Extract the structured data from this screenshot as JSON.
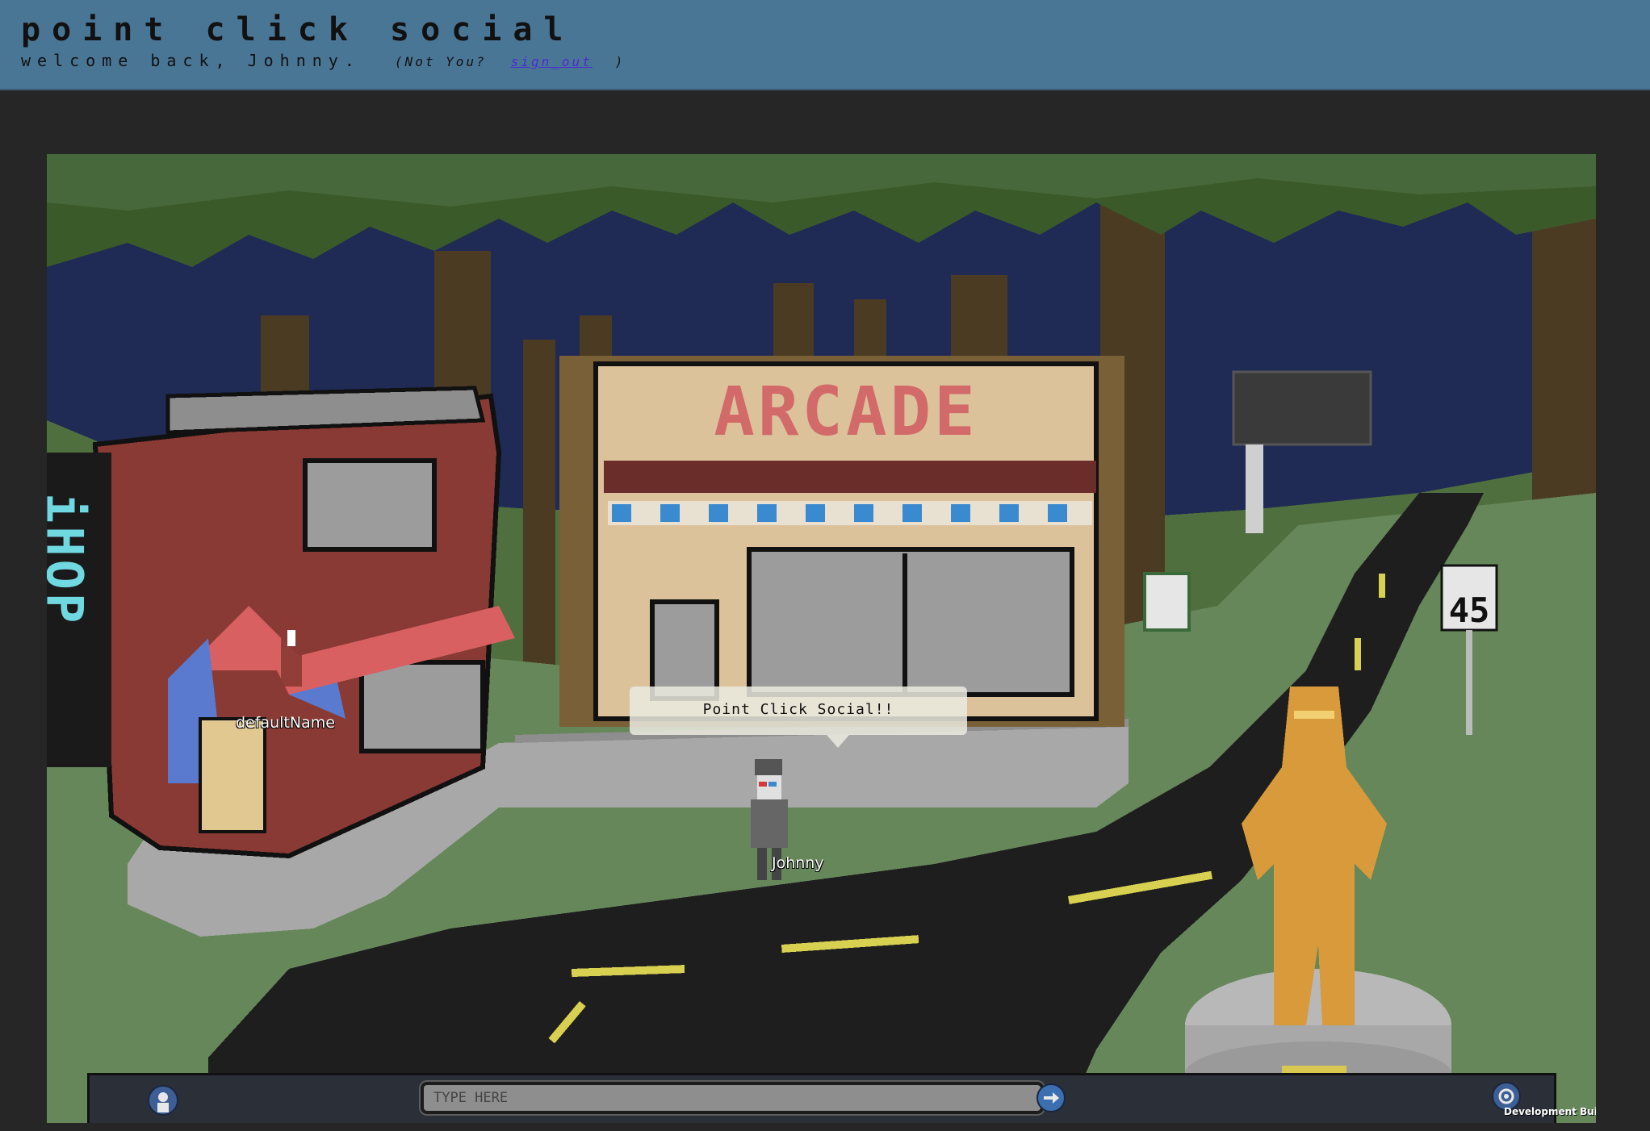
{
  "header": {
    "title": "point click social",
    "welcome": "welcome back, Johnny.",
    "not_you_prefix": "(Not You?",
    "sign_out_label": "sign_out",
    "not_you_suffix": ")"
  },
  "scene": {
    "shop_sign": "iHOP",
    "building_sign": "ARCADE",
    "speed_sign": "45",
    "speech_bubble": "Point Click Social!!",
    "players": [
      {
        "name": "defaultName"
      },
      {
        "name": "Johnny"
      }
    ]
  },
  "chat": {
    "placeholder": "TYPE HERE",
    "icons": {
      "avatar": "avatar-icon",
      "send": "arrow-right-icon",
      "settings": "gear-icon"
    }
  },
  "build_label": "Development Build",
  "colors": {
    "header_bg": "#4a7696",
    "page_bg": "#262626",
    "sky": "#1f2a55",
    "foliage": "#3b5a2a",
    "grass": "#6a8a5a",
    "road": "#1e1e1e",
    "road_line": "#d8d050",
    "sidewalk": "#a8a8a8",
    "brick": "#8a3a34",
    "arcade_wall": "#dcc29a",
    "arcade_text": "#d26a6a",
    "statue": "#d89a3a",
    "sign_text": "#70d8e0"
  }
}
